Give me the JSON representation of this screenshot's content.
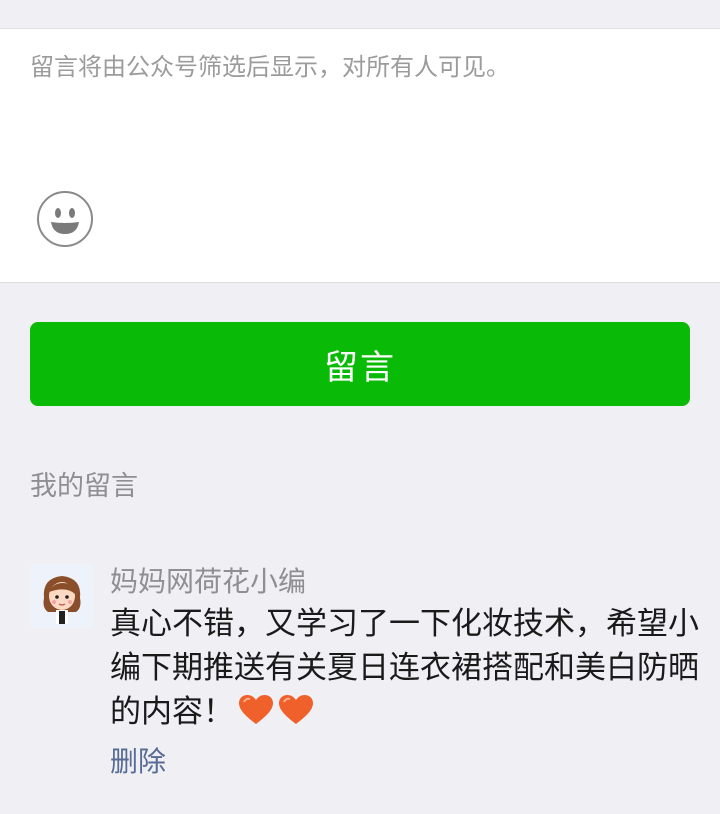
{
  "input": {
    "placeholder": "留言将由公众号筛选后显示，对所有人可见。",
    "emoji_icon": "smiley-face-icon"
  },
  "submit": {
    "label": "留言"
  },
  "my_comments": {
    "title": "我的留言",
    "items": [
      {
        "nickname": "妈妈网荷花小编",
        "text": "真心不错，又学习了一下化妆技术，希望小编下期推送有关夏日连衣裙搭配和美白防晒的内容！",
        "emojis": [
          "heart-icon",
          "heart-icon"
        ],
        "delete_label": "删除"
      }
    ]
  },
  "colors": {
    "accent_green": "#09bb07",
    "link_blue": "#576b95",
    "page_bg": "#efeff4",
    "heart_orange": "#f0602a"
  }
}
